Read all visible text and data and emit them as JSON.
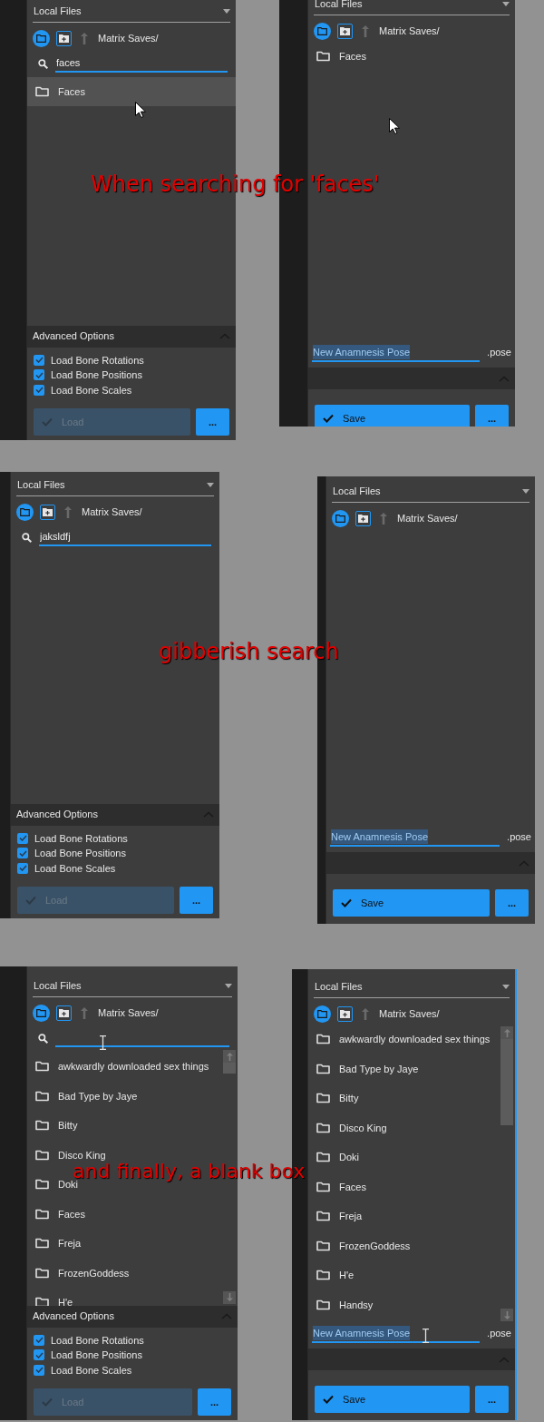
{
  "sections": [
    {
      "caption": "When searching for 'faces'",
      "panels": [
        {
          "kind": "load",
          "source": "Local Files",
          "path": "Matrix Saves/",
          "search_shown": true,
          "search_value": "faces",
          "files": [
            {
              "name": "Faces",
              "selected": true
            }
          ],
          "options_title": "Advanced Options",
          "options": [
            {
              "label": "Load Bone Rotations",
              "checked": true
            },
            {
              "label": "Load Bone Positions",
              "checked": true
            },
            {
              "label": "Load Bone Scales",
              "checked": true
            }
          ],
          "action": {
            "label": "Load",
            "disabled": true
          },
          "more": "..."
        },
        {
          "kind": "save",
          "source": "Local Files",
          "path": "Matrix Saves/",
          "files": [
            {
              "name": "Faces",
              "selected": false
            }
          ],
          "filename": {
            "value": "New Anamnesis Pose",
            "selected": true
          },
          "extension": ".pose",
          "action": {
            "label": "Save",
            "disabled": false
          },
          "more": "..."
        }
      ]
    },
    {
      "caption": "gibberish search",
      "panels": [
        {
          "kind": "load",
          "source": "Local Files",
          "path": "Matrix Saves/",
          "search_shown": true,
          "search_value": "jaksldfj",
          "options_title": "Advanced Options",
          "options": [
            {
              "label": "Load Bone Rotations",
              "checked": true
            },
            {
              "label": "Load Bone Positions",
              "checked": true
            },
            {
              "label": "Load Bone Scales",
              "checked": true
            }
          ],
          "action": {
            "label": "Load",
            "disabled": true
          },
          "more": "..."
        },
        {
          "kind": "save",
          "source": "Local Files",
          "path": "Matrix Saves/",
          "filename": {
            "value": "New Anamnesis Pose",
            "selected": true
          },
          "extension": ".pose",
          "action": {
            "label": "Save",
            "disabled": false
          },
          "more": "..."
        }
      ]
    },
    {
      "caption": "and finally, a blank box",
      "panels": [
        {
          "kind": "load",
          "source": "Local Files",
          "path": "Matrix Saves/",
          "search_shown": true,
          "files": [
            {
              "name": "awkwardly downloaded sex things",
              "selected": false
            },
            {
              "name": "Bad Type by Jaye",
              "selected": false
            },
            {
              "name": "Bitty",
              "selected": false
            },
            {
              "name": "Disco King",
              "selected": false
            },
            {
              "name": "Doki",
              "selected": false
            },
            {
              "name": "Faces",
              "selected": false
            },
            {
              "name": "Freja",
              "selected": false
            },
            {
              "name": "FrozenGoddess",
              "selected": false
            },
            {
              "name": "H'e",
              "selected": false
            }
          ],
          "options_title": "Advanced Options",
          "options": [
            {
              "label": "Load Bone Rotations",
              "checked": true
            },
            {
              "label": "Load Bone Positions",
              "checked": true
            },
            {
              "label": "Load Bone Scales",
              "checked": true
            }
          ],
          "action": {
            "label": "Load",
            "disabled": true
          },
          "more": "..."
        },
        {
          "kind": "save",
          "source": "Local Files",
          "path": "Matrix Saves/",
          "files": [
            {
              "name": "awkwardly downloaded sex things",
              "selected": false
            },
            {
              "name": "Bad Type by Jaye",
              "selected": false
            },
            {
              "name": "Bitty",
              "selected": false
            },
            {
              "name": "Disco King",
              "selected": false
            },
            {
              "name": "Doki",
              "selected": false
            },
            {
              "name": "Faces",
              "selected": false
            },
            {
              "name": "Freja",
              "selected": false
            },
            {
              "name": "FrozenGoddess",
              "selected": false
            },
            {
              "name": "H'e",
              "selected": false
            },
            {
              "name": "Handsy",
              "selected": false
            }
          ],
          "filename": {
            "value": "New Anamnesis Pose",
            "selected": true
          },
          "extension": ".pose",
          "action": {
            "label": "Save",
            "disabled": false
          },
          "more": "..."
        }
      ]
    }
  ]
}
